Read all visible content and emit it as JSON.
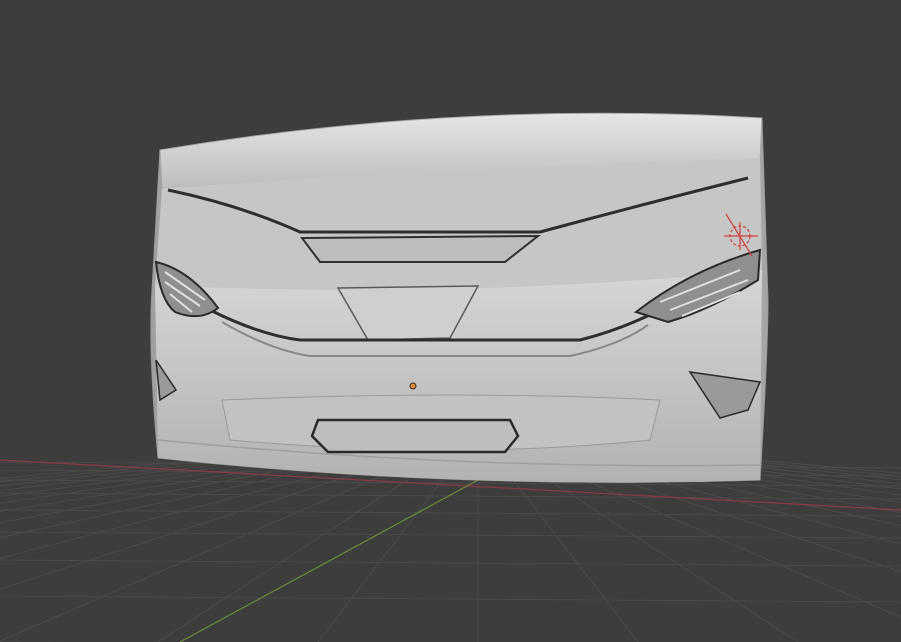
{
  "viewport": {
    "background_color": "#3d3d3d",
    "floor_grid_color": "#4a4a4a",
    "x_axis_color": "#8a3b45",
    "y_axis_color": "#6a8a3a"
  },
  "object": {
    "type": "vehicle-front-bumper-mesh",
    "shading": "matcap-clay",
    "base_color": "#c8c8c8",
    "shadow_color": "#8a8a8a",
    "highlight_color": "#eeeeee",
    "crease_color": "#2a2a2a"
  },
  "origin": {
    "icon": "origin-dot-icon",
    "color": "#e08a3a"
  },
  "light_gizmo": {
    "icon": "light-sun-icon",
    "color": "#d04040"
  }
}
